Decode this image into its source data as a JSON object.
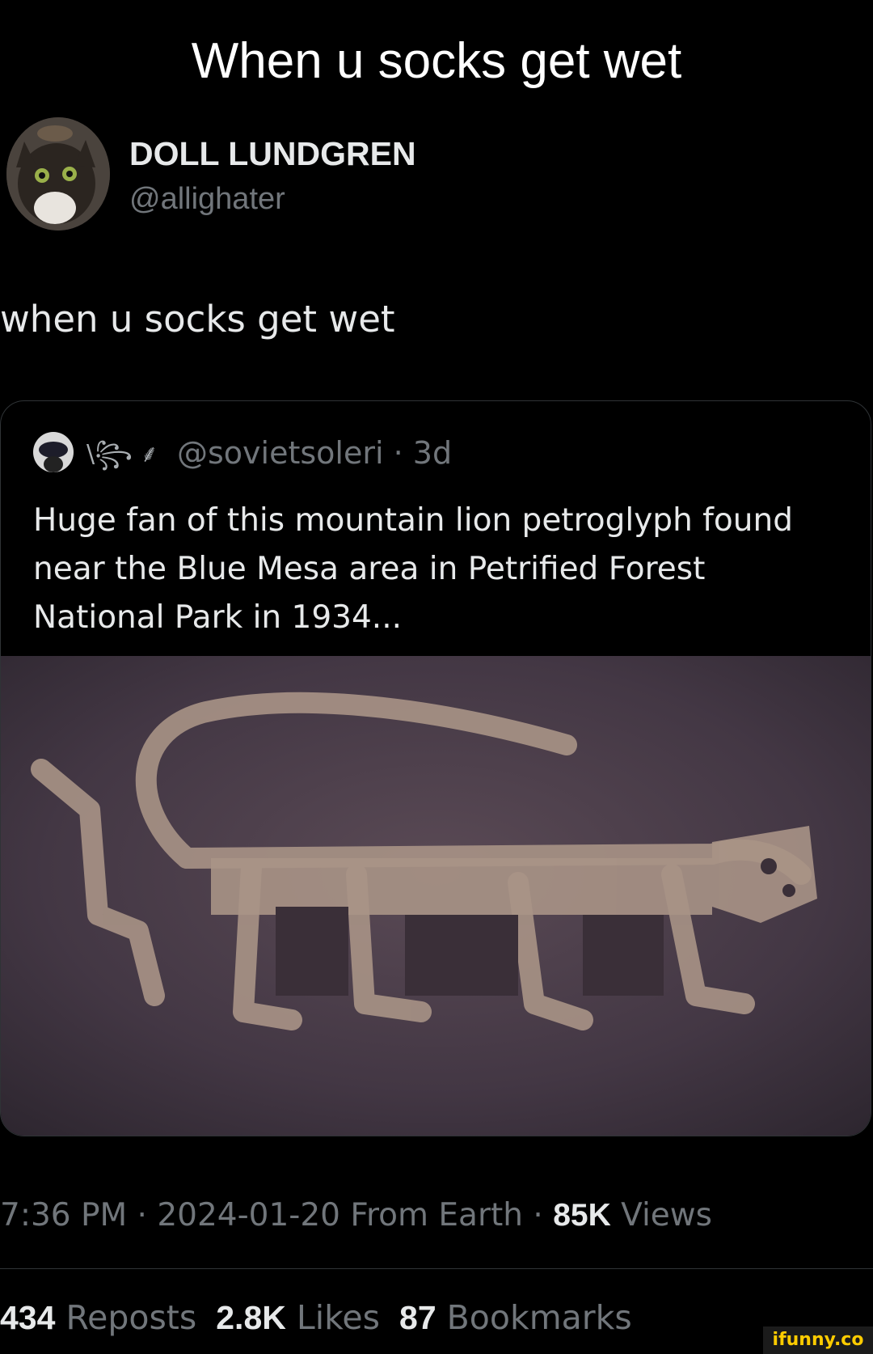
{
  "caption": "When u socks get wet",
  "author": {
    "display_name": "DOLL LUNDGREN",
    "handle": "@allighater",
    "avatar_icon": "cat-avatar-icon"
  },
  "tweet_text": "when u socks get wet",
  "quote": {
    "avatar_icon": "user-avatar-icon",
    "emoji_decoration": "\\꧂ ⸙",
    "handle_time": "@sovietsoleri · 3d",
    "text_lines": [
      "Huge fan of this mountain lion petroglyph found",
      "near the Blue Mesa area in Petrified Forest",
      "National Park in 1934..."
    ],
    "image_icon": "petroglyph-photo"
  },
  "meta": {
    "time_date_source": "7:36 PM · 2024-01-20 From Earth · ",
    "views_count": "85K",
    "views_label": " Views"
  },
  "stats": {
    "reposts_count": "434",
    "reposts_label": "Reposts",
    "likes_count": "2.8K",
    "likes_label": "Likes",
    "bookmarks_count": "87",
    "bookmarks_label": "Bookmarks"
  },
  "watermark": "ifunny.co"
}
